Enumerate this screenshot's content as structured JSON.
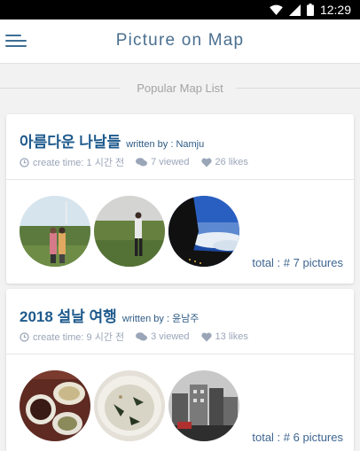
{
  "status_bar": {
    "time": "12:29",
    "icons": [
      "wifi-icon",
      "signal-icon",
      "battery-icon"
    ]
  },
  "app_bar": {
    "title": "Picture on Map",
    "menu_icon": "hamburger-menu-icon"
  },
  "section": {
    "title": "Popular Map List"
  },
  "colors": {
    "accent": "#1e5a8c",
    "title": "#4a6f8f",
    "meta": "#9aa5b8",
    "total": "#3e6590"
  },
  "maps": [
    {
      "title": "아름다운 나날들",
      "author": "written by : Namju",
      "create_time": "create time: 1 시간 전",
      "views": "7 viewed",
      "likes": "26 likes",
      "total": "total : # 7 pictures",
      "photos": [
        "couple-on-grass-photo",
        "man-in-field-photo",
        "mountain-cloud-photo"
      ]
    },
    {
      "title": "2018 설날 여행",
      "author": "written by : 윤남주",
      "create_time": "create time: 9 시간 전",
      "views": "3 viewed",
      "likes": "13 likes",
      "total": "total : # 6 pictures",
      "photos": [
        "korean-dishes-photo",
        "rice-porridge-photo",
        "city-buildings-photo"
      ]
    }
  ]
}
